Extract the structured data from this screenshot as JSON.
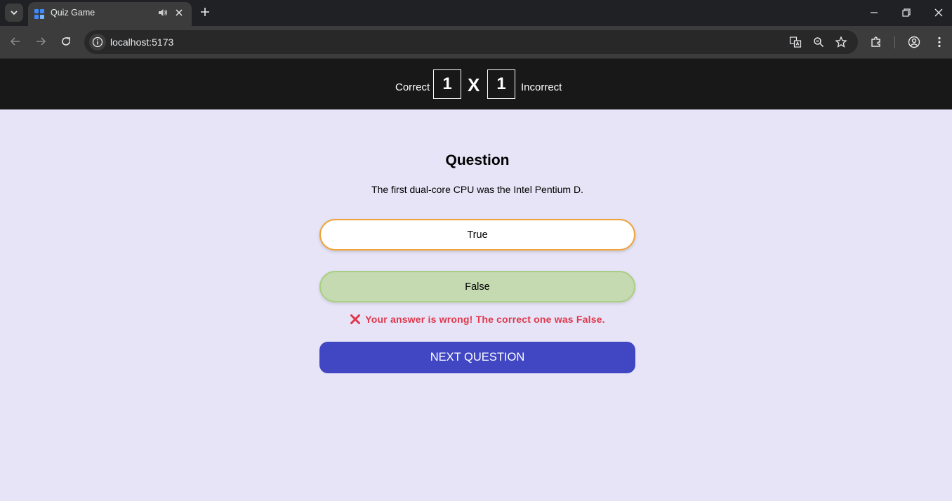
{
  "browser": {
    "tab_title": "Quiz Game",
    "url": "localhost:5173"
  },
  "score": {
    "correct_label": "Correct",
    "correct_count": "1",
    "separator": "X",
    "incorrect_count": "1",
    "incorrect_label": "Incorrect"
  },
  "question": {
    "heading": "Question",
    "text": "The first dual-core CPU was the Intel Pentium D."
  },
  "answers": [
    {
      "label": "True",
      "state": "selected-wrong"
    },
    {
      "label": "False",
      "state": "correct"
    }
  ],
  "feedback": {
    "message": "Your answer is wrong! The correct one was False."
  },
  "next_button": {
    "label": "NEXT QUESTION"
  },
  "colors": {
    "page_bg": "#e6e4f6",
    "scorebar_bg": "#181818",
    "selected_border": "#f0a43a",
    "correct_fill": "#c5dab0",
    "error_text": "#e0374c",
    "primary_button": "#4147c3"
  }
}
